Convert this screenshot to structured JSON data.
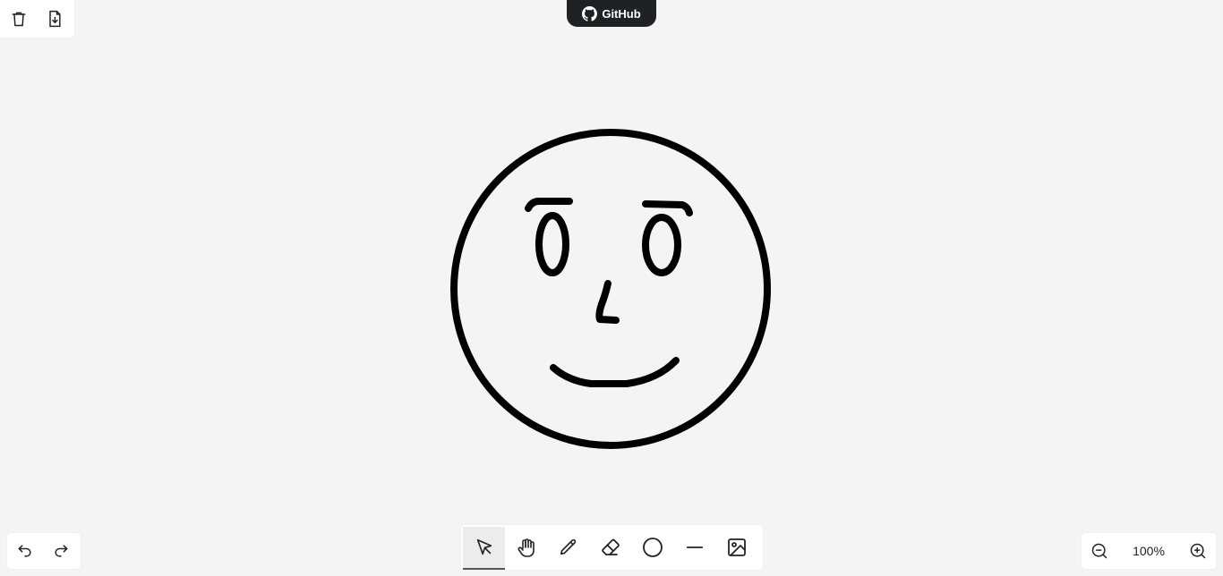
{
  "file_menu": {
    "clear_icon": "trash-icon",
    "export_icon": "file-download-icon"
  },
  "github": {
    "label": "GitHub",
    "icon": "github-icon"
  },
  "history": {
    "undo_icon": "undo-icon",
    "redo_icon": "redo-icon"
  },
  "toolbar": {
    "active_tool": "select",
    "tools": [
      {
        "id": "select",
        "icon": "cursor-arrow-icon"
      },
      {
        "id": "hand",
        "icon": "hand-icon"
      },
      {
        "id": "pencil",
        "icon": "pencil-icon"
      },
      {
        "id": "eraser",
        "icon": "eraser-icon"
      },
      {
        "id": "ellipse",
        "icon": "circle-icon"
      },
      {
        "id": "line",
        "icon": "line-icon"
      },
      {
        "id": "image",
        "icon": "image-icon"
      }
    ]
  },
  "zoom": {
    "level": "100%",
    "zoom_out_icon": "zoom-out-icon",
    "zoom_in_icon": "zoom-in-icon"
  },
  "colors": {
    "background": "#f4f4f4",
    "panel": "#ffffff",
    "stroke": "#000000",
    "github_bg": "#1f2125"
  }
}
